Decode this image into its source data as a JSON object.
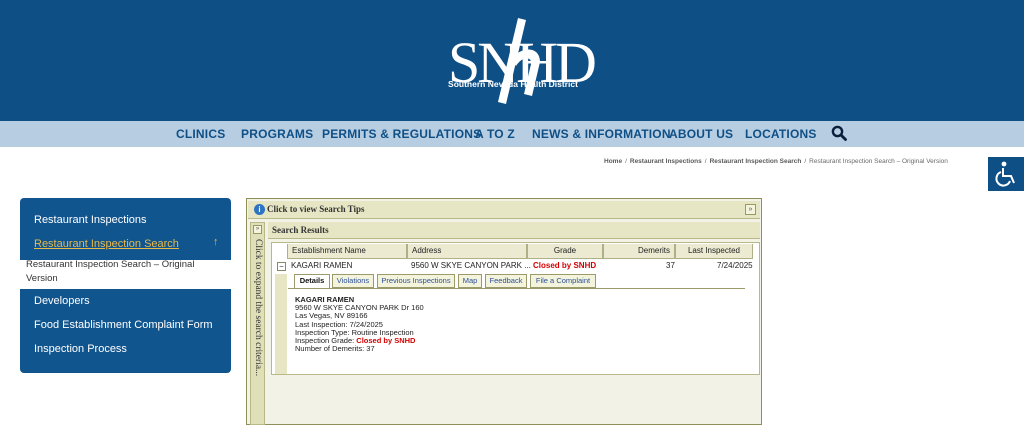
{
  "header": {
    "logo_letters": "SNHD",
    "logo_tagline": "Southern Nevada Health District"
  },
  "nav": {
    "items": [
      "CLINICS",
      "PROGRAMS",
      "PERMITS & REGULATIONS",
      "A TO Z",
      "NEWS & INFORMATION",
      "ABOUT US",
      "LOCATIONS"
    ],
    "search_icon": "search-icon"
  },
  "breadcrumb": [
    "Home",
    "Restaurant Inspections",
    "Restaurant Inspection Search",
    "Restaurant Inspection Search – Original Version"
  ],
  "accessibility_icon": "wheelchair-icon",
  "sidebar": {
    "items": [
      {
        "label": "Restaurant Inspections"
      },
      {
        "label": "Restaurant Inspection Search",
        "active": true
      },
      {
        "label": "Restaurant Inspection Search – Original Version"
      },
      {
        "label": "Developers"
      },
      {
        "label": "Food Establishment Complaint Form"
      },
      {
        "label": "Inspection Process"
      }
    ]
  },
  "search_panel": {
    "tips_label": "Click to view Search Tips",
    "expand_label": "Click to expand the search criteria...",
    "results_title": "Search Results",
    "columns": [
      "Establishment Name",
      "Address",
      "Grade",
      "Demerits",
      "Last Inspected"
    ],
    "row": {
      "name": "KAGARI RAMEN",
      "address": "9560 W SKYE CANYON PARK ...",
      "grade": "Closed by SNHD",
      "demerits": "37",
      "last_inspected": "7/24/2025"
    },
    "tabs": [
      "Details",
      "Violations",
      "Previous Inspections",
      "Map",
      "Feedback",
      "File a Complaint"
    ],
    "details": {
      "name": "KAGARI RAMEN",
      "address_line1": "9560 W SKYE CANYON PARK Dr 160",
      "address_line2": "Las Vegas, NV 89166",
      "last_inspection": "Last Inspection: 7/24/2025",
      "inspection_type": "Inspection Type: Routine Inspection",
      "grade_label": "Inspection Grade: ",
      "grade_value": "Closed by SNHD",
      "demerits": "Number of Demerits: 37"
    },
    "grade_color": "#d40000"
  }
}
